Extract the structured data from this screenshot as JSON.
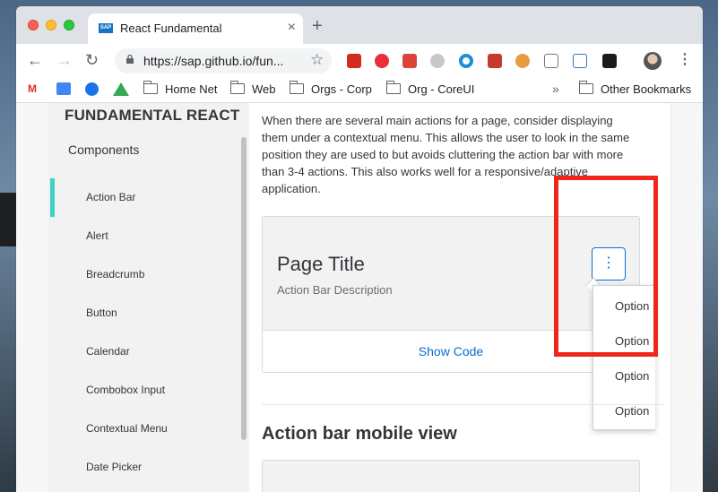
{
  "browser": {
    "tab_title": "React Fundamental",
    "tab_favicon": "SAP",
    "tab_close": "×",
    "new_tab": "+",
    "back": "←",
    "forward": "→",
    "reload": "↻",
    "url": "https://sap.github.io/fun...",
    "star": "☆",
    "menu": "⋮"
  },
  "bookmarks": {
    "items": [
      "Home Net",
      "Web",
      "Orgs - Corp",
      "Org - CoreUI"
    ],
    "overflow": "»",
    "other": "Other Bookmarks"
  },
  "sidebar": {
    "brand": "FUNDAMENTAL REACT",
    "section": "Components",
    "items": [
      {
        "label": "Action Bar",
        "active": true
      },
      {
        "label": "Alert"
      },
      {
        "label": "Breadcrumb"
      },
      {
        "label": "Button"
      },
      {
        "label": "Calendar"
      },
      {
        "label": "Combobox Input"
      },
      {
        "label": "Contextual Menu"
      },
      {
        "label": "Date Picker"
      }
    ]
  },
  "main": {
    "intro": "When there are several main actions for a page, consider displaying them under a contextual menu. This allows the user to look in the same position they are used to but avoids cluttering the action bar with more than 3-4 actions. This also works well for a responsive/adaptive application.",
    "example": {
      "title": "Page Title",
      "description": "Action Bar Description",
      "menu_icon": "⋮",
      "show_code": "Show Code",
      "options": [
        "Option",
        "Option",
        "Option",
        "Option"
      ]
    },
    "section_title": "Action bar mobile view"
  },
  "colors": {
    "accent": "#0a6ed1",
    "active_marker": "#3fd2c7",
    "highlight": "#f0261b"
  }
}
